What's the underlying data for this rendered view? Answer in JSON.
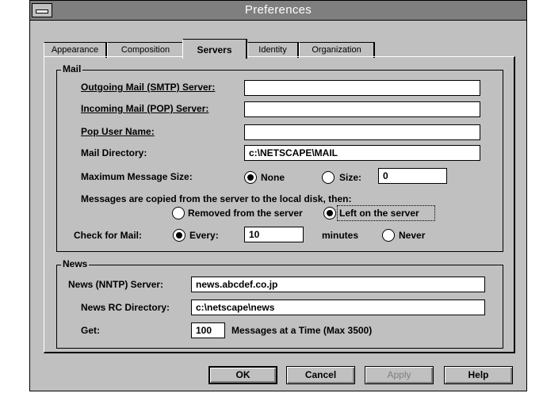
{
  "window": {
    "title": "Preferences"
  },
  "tabs": [
    "Appearance",
    "Composition",
    "Servers",
    "Identity",
    "Organization"
  ],
  "mail": {
    "group_title": "Mail",
    "smtp_label": "Outgoing Mail (SMTP) Server:",
    "smtp_value": "",
    "pop_label": "Incoming Mail (POP) Server:",
    "pop_value": "",
    "user_label": "Pop User Name:",
    "user_value": "",
    "dir_label": "Mail Directory:",
    "dir_value": "c:\\NETSCAPE\\MAIL",
    "max_label": "Maximum Message Size:",
    "max_none": "None",
    "max_size": "Size:",
    "max_size_value": "0",
    "copy_text": "Messages are copied from the server to the local disk, then:",
    "removed_label": "Removed from the server",
    "left_label": "Left on the server",
    "check_label": "Check for Mail:",
    "every_label": "Every:",
    "every_value": "10",
    "minutes_label": "minutes",
    "never_label": "Never"
  },
  "news": {
    "group_title": "News",
    "nntp_label": "News (NNTP) Server:",
    "nntp_value": "news.abcdef.co.jp",
    "rc_label": "News RC Directory:",
    "rc_value": "c:\\netscape\\news",
    "get_label": "Get:",
    "get_value": "100",
    "get_suffix": "Messages at a Time (Max 3500)"
  },
  "buttons": {
    "ok": "OK",
    "cancel": "Cancel",
    "apply": "Apply",
    "help": "Help"
  }
}
